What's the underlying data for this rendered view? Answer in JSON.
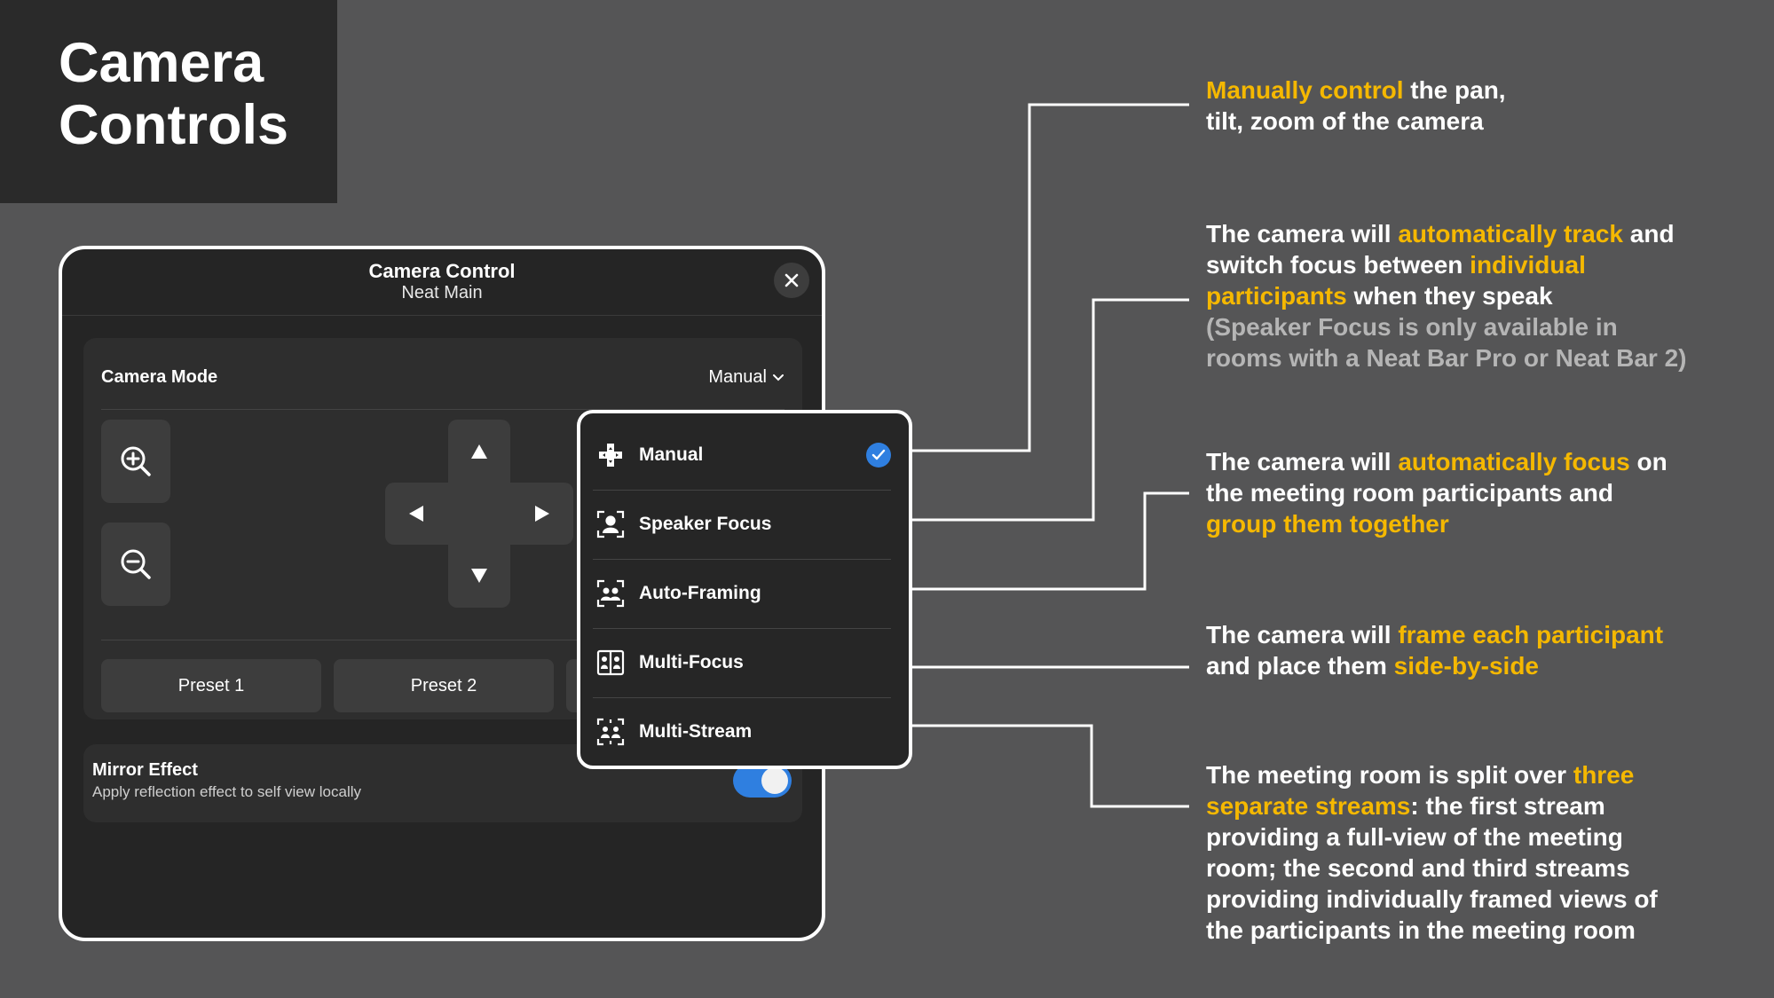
{
  "title": "Camera Controls",
  "window": {
    "title": "Camera Control",
    "subtitle": "Neat Main",
    "camera_mode_label": "Camera Mode",
    "camera_mode_value": "Manual",
    "presets": [
      "Preset 1",
      "Preset 2"
    ],
    "mirror": {
      "title": "Mirror Effect",
      "subtitle": "Apply reflection effect to self view locally",
      "enabled": true
    }
  },
  "dropdown": {
    "selected": "Manual",
    "items": [
      {
        "label": "Manual",
        "icon": "move-cross-icon"
      },
      {
        "label": "Speaker Focus",
        "icon": "speaker-focus-icon"
      },
      {
        "label": "Auto-Framing",
        "icon": "auto-framing-icon"
      },
      {
        "label": "Multi-Focus",
        "icon": "multi-focus-icon"
      },
      {
        "label": "Multi-Stream",
        "icon": "multi-stream-icon"
      }
    ]
  },
  "annotations": {
    "manual": {
      "hl1": "Manually control",
      "t1": " the pan,",
      "t2": "tilt, zoom of the camera"
    },
    "speaker": {
      "t1": "The camera will ",
      "hl1": "automatically track",
      "t2": " and",
      "t3": "switch focus between ",
      "hl2": "individual",
      "hl3": "participants",
      "t4": " when they speak",
      "gray1": "(Speaker Focus is only available in",
      "gray2": "rooms with a Neat Bar Pro or Neat Bar 2)"
    },
    "autoframing": {
      "t1": "The camera will ",
      "hl1": "automatically focus",
      "t2": " on",
      "t3": "the meeting room participants and",
      "hl2": "group them together"
    },
    "multifocus": {
      "t1": "The camera will ",
      "hl1": "frame each participant",
      "t2": "and place them ",
      "hl2": "side-by-side"
    },
    "multistream": {
      "t1": "The meeting room is split over ",
      "hl1": "three",
      "hl2": "separate streams",
      "t2": ": the first stream",
      "t3": "providing a full-view of the meeting",
      "t4": "room; the second and third streams",
      "t5": "providing individually framed views of",
      "t6": "the participants in the meeting room"
    }
  },
  "colors": {
    "accent": "#f5b800",
    "toggle_blue": "#2f7fe0",
    "background": "#555556"
  }
}
